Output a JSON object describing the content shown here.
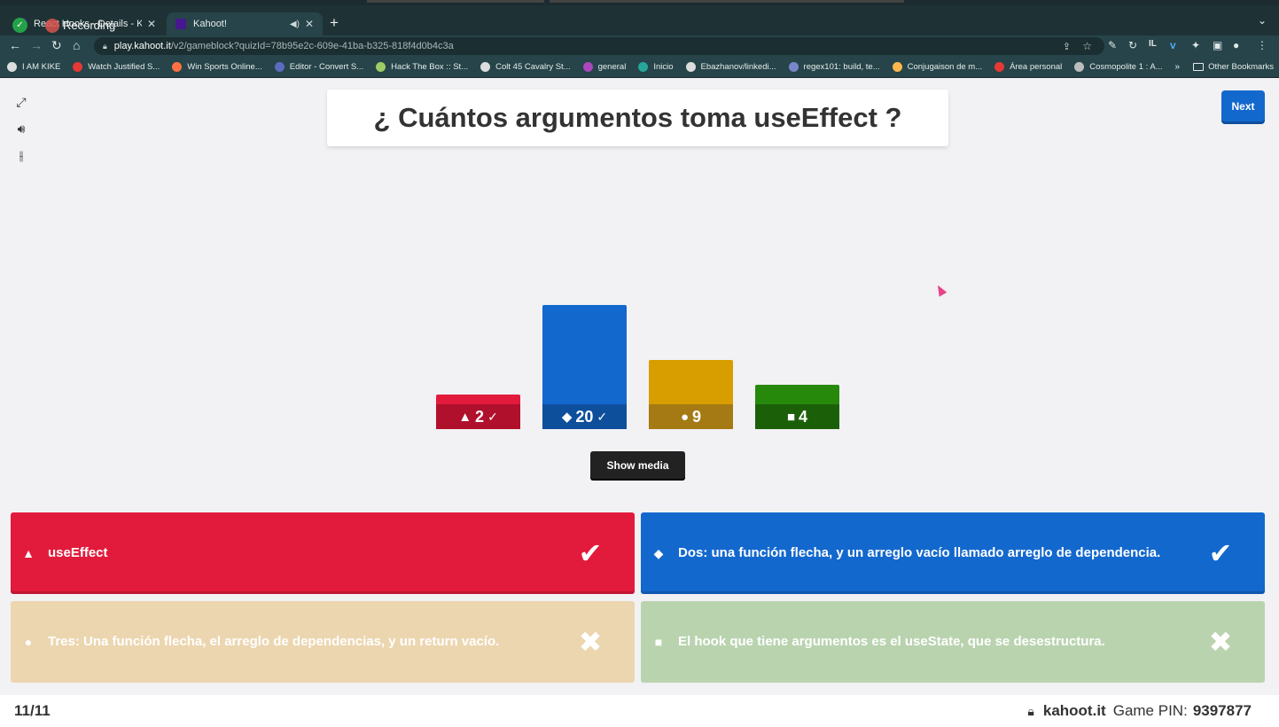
{
  "browser": {
    "tabs": [
      {
        "title": "React Hooks - Details - Kahoot!",
        "active": false,
        "icon_color": "#46178f"
      },
      {
        "title": "Kahoot!",
        "active": true,
        "icon_color": "#46178f"
      }
    ],
    "recording_label": "Recording",
    "url_host": "play.kahoot.it",
    "url_path": "/v2/gameblock?quizId=78b95e2c-609e-41ba-b325-818f4d0b4c3a",
    "bookmarks": [
      {
        "label": "I AM KIKE",
        "color": "#dddddd"
      },
      {
        "label": "Watch Justified S...",
        "color": "#e53935"
      },
      {
        "label": "Win Sports Online...",
        "color": "#ff7043"
      },
      {
        "label": "Editor - Convert S...",
        "color": "#5c6bc0"
      },
      {
        "label": "Hack The Box :: St...",
        "color": "#9ccc65"
      },
      {
        "label": "Colt 45 Cavalry St...",
        "color": "#dddddd"
      },
      {
        "label": "general",
        "color": "#ab47bc"
      },
      {
        "label": "Inicio",
        "color": "#26a69a"
      },
      {
        "label": "Ebazhanov/linkedi...",
        "color": "#dddddd"
      },
      {
        "label": "regex101: build, te...",
        "color": "#7986cb"
      },
      {
        "label": "Conjugaison de m...",
        "color": "#ffb74d"
      },
      {
        "label": "Área personal",
        "color": "#e53935"
      },
      {
        "label": "Cosmopolite 1 : A...",
        "color": "#bdbdbd"
      }
    ],
    "bookmarks_more": "»",
    "other_bookmarks": "Other Bookmarks"
  },
  "game": {
    "question": "¿ Cuántos argumentos toma useEffect ?",
    "next_label": "Next",
    "show_media_label": "Show media",
    "counter": "11/11",
    "site": "kahoot.it",
    "pin_label": "Game PIN:",
    "pin": "9397877"
  },
  "chart_data": {
    "type": "bar",
    "categories": [
      "triangle",
      "diamond",
      "circle",
      "square"
    ],
    "values": [
      2,
      20,
      9,
      4
    ],
    "correct": [
      true,
      true,
      false,
      false
    ],
    "colors": [
      "#e21b3c",
      "#1368ce",
      "#d89e00",
      "#26890c"
    ],
    "base_colors": [
      "#b0102c",
      "#0e4f9c",
      "#a57a14",
      "#1b6009"
    ]
  },
  "answers": [
    {
      "shape": "▲",
      "text": "useEffect",
      "correct": true,
      "color": "#e21b3c",
      "faded": false
    },
    {
      "shape": "◆",
      "text": "Dos: una función flecha, y un arreglo vacío llamado arreglo de dependencia.",
      "correct": true,
      "color": "#1368ce",
      "faded": false
    },
    {
      "shape": "●",
      "text": "Tres: Una función flecha, el arreglo de dependencias, y un return vacío.",
      "correct": false,
      "color": "#ecd6b0",
      "faded": true
    },
    {
      "shape": "■",
      "text": "El hook que tiene argumentos es el useState, que se desestructura.",
      "correct": false,
      "color": "#b9d3af",
      "faded": true
    }
  ]
}
